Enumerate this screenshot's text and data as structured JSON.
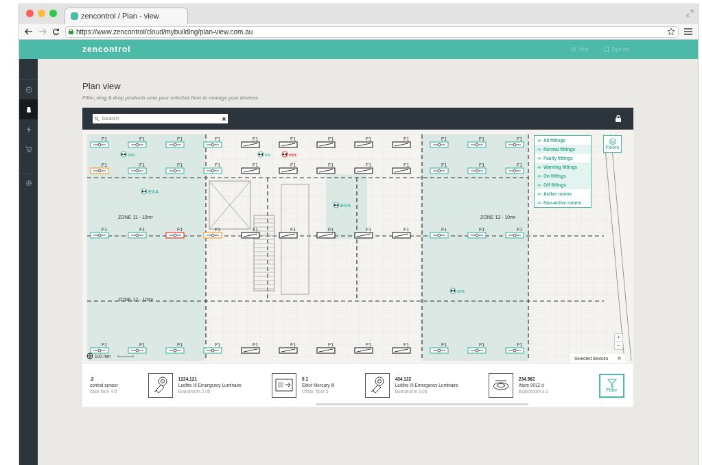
{
  "browser": {
    "tab_title": "zencontrol / Plan - view",
    "url": "https://www.zencontrol/cloud/mybuilding/plan-view.com.au"
  },
  "header": {
    "logo": "zencontrol",
    "help": "Help",
    "sign_out": "Sign out"
  },
  "sidebar": {
    "items": [
      {
        "kind": "dashboard",
        "selected": false
      },
      {
        "kind": "building",
        "selected": true
      },
      {
        "kind": "energy",
        "selected": false
      },
      {
        "kind": "cart",
        "selected": false
      },
      {
        "kind": "settings",
        "selected": false
      }
    ]
  },
  "page": {
    "title": "Plan view",
    "subtitle": "Filter, drag & drop products onto your selected floor to manage your devices."
  },
  "search": {
    "placeholder": "Search"
  },
  "plan": {
    "zones": [
      "ZONE 11 - 10m²",
      "ZONE 12 - 10m²",
      "ZONE 13 - 10m²"
    ],
    "fitting_rows": [
      [
        {
          "label": "F1",
          "kind": "normal"
        },
        {
          "label": "F1",
          "kind": "normal"
        },
        {
          "label": "F1",
          "kind": "normal"
        },
        {
          "label": "F1",
          "kind": "normal"
        },
        {
          "label": "F1",
          "kind": "off"
        },
        {
          "label": "F1",
          "kind": "off"
        },
        {
          "label": "F1",
          "kind": "off"
        },
        {
          "label": "F1",
          "kind": "off"
        },
        {
          "label": "F1",
          "kind": "off"
        },
        {
          "label": "F1",
          "kind": "normal"
        },
        {
          "label": "F1",
          "kind": "normal"
        },
        {
          "label": "F1",
          "kind": "normal"
        }
      ],
      [
        {
          "label": "F1",
          "kind": "warning"
        },
        {
          "label": "F1",
          "kind": "normal"
        },
        {
          "label": "F1",
          "kind": "normal"
        },
        {
          "label": "F1",
          "kind": "normal"
        },
        {
          "label": "F1",
          "kind": "off"
        },
        {
          "label": "F1",
          "kind": "off"
        },
        {
          "label": "F1",
          "kind": "off"
        },
        {
          "label": "F1",
          "kind": "off"
        },
        {
          "label": "F1",
          "kind": "off"
        },
        {
          "label": "F1",
          "kind": "normal"
        },
        {
          "label": "F1",
          "kind": "normal"
        },
        {
          "label": "F1",
          "kind": "normal"
        }
      ],
      [
        {
          "label": "F1",
          "kind": "normal"
        },
        {
          "label": "F1",
          "kind": "normal"
        },
        {
          "label": "F1",
          "kind": "faulty"
        },
        {
          "label": "F1",
          "kind": "warning"
        },
        {
          "label": "F1",
          "kind": "off"
        },
        {
          "label": "F1",
          "kind": "off"
        },
        {
          "label": "F1",
          "kind": "off"
        },
        {
          "label": "F1",
          "kind": "off"
        },
        {
          "label": "F1",
          "kind": "off"
        },
        {
          "label": "F1",
          "kind": "normal"
        },
        {
          "label": "F1",
          "kind": "normal"
        },
        {
          "label": "F1",
          "kind": "normal"
        }
      ],
      [
        {
          "label": "F1",
          "kind": "normal"
        },
        {
          "label": "F1",
          "kind": "normal"
        },
        {
          "label": "F1",
          "kind": "normal"
        },
        {
          "label": "F1",
          "kind": "normal"
        },
        {
          "label": "F1",
          "kind": "off"
        },
        {
          "label": "F1",
          "kind": "off"
        },
        {
          "label": "F1",
          "kind": "off"
        },
        {
          "label": "F1",
          "kind": "off"
        },
        {
          "label": "F1",
          "kind": "off"
        },
        {
          "label": "F1",
          "kind": "normal"
        },
        {
          "label": "F1",
          "kind": "normal"
        },
        {
          "label": "F1",
          "kind": "normal"
        }
      ]
    ],
    "markers": [
      {
        "label": "em",
        "kind": "normal"
      },
      {
        "label": "EXA",
        "kind": "normal"
      },
      {
        "label": "ex",
        "kind": "normal"
      },
      {
        "label": "em",
        "kind": "faulty"
      },
      {
        "label": "EXA",
        "kind": "normal"
      },
      {
        "label": "em",
        "kind": "normal"
      }
    ],
    "scale": "100 mm"
  },
  "filter_menu": [
    {
      "label": "All fittings",
      "selected": false
    },
    {
      "label": "Normal fittings",
      "selected": true
    },
    {
      "label": "Faulty fittings",
      "selected": false
    },
    {
      "label": "Warning fittings",
      "selected": true
    },
    {
      "label": "On fittings",
      "selected": true
    },
    {
      "label": "Off fittings",
      "selected": true
    },
    {
      "label": "Active rooms",
      "selected": false
    },
    {
      "label": "Non-active rooms",
      "selected": false
    }
  ],
  "floors_button": "Floors",
  "zoom": {
    "in": "+",
    "out": "−"
  },
  "selected_devices": {
    "label": "Selected devices",
    "expanded": false
  },
  "devices": [
    {
      "kind": "none",
      "code": ".3",
      "name": "control sensor",
      "location": "case floor 4-5"
    },
    {
      "kind": "emergency",
      "code": "1224.121",
      "name": "Ledfire III Emergency Luminaire",
      "location": "Boardroom 2.05"
    },
    {
      "kind": "exit",
      "code": "0.1",
      "name": "Ektor Mercury III",
      "location": "Office, floor 5"
    },
    {
      "kind": "emergency",
      "code": "434.122",
      "name": "Ledfire III Emergency Luminaire",
      "location": "Boardroom 3.06"
    },
    {
      "kind": "downlight",
      "code": "234.562",
      "name": "Atom  9012 d",
      "location": "Boardroom 3.0"
    }
  ],
  "filter_button": "Filter"
}
